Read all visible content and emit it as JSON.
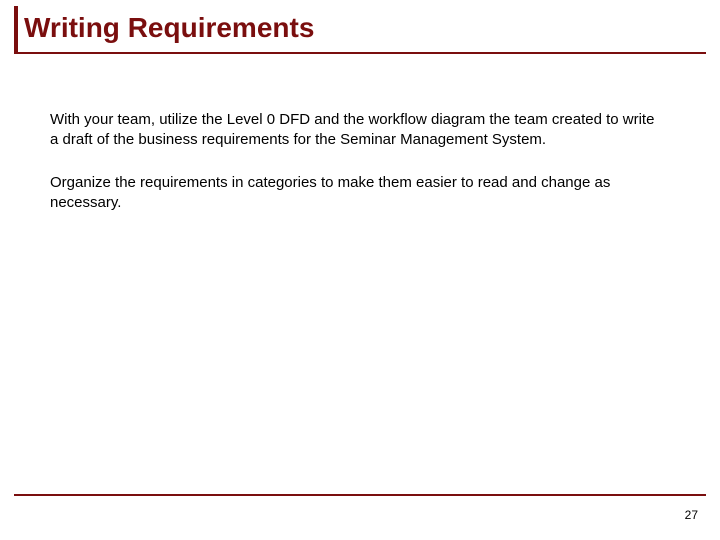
{
  "title": "Writing Requirements",
  "paragraphs": [
    "With your team, utilize the Level 0 DFD and the workflow diagram the team created to write a draft of the business requirements for the Seminar Management System.",
    "Organize the requirements in categories to make them easier to read and change as necessary."
  ],
  "page_number": "27"
}
